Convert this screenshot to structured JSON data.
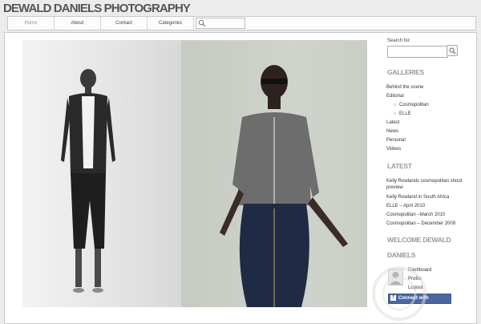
{
  "site": {
    "title": "DEWALD DANIELS PHOTOGRAPHY"
  },
  "nav": {
    "items": [
      {
        "label": "Home"
      },
      {
        "label": "About"
      },
      {
        "label": "Contact"
      },
      {
        "label": "Categories"
      }
    ],
    "search_icon": "search-icon"
  },
  "sidebar": {
    "search": {
      "label": "Search for:",
      "value": ""
    },
    "galleries": {
      "title": "GALLERIES",
      "items": [
        "Behind the scene",
        "Editorial",
        "Latest",
        "News",
        "Personal",
        "Videos"
      ],
      "editorial_sub": [
        "Cosmopolitan",
        "ELLE"
      ]
    },
    "latest": {
      "title": "LATEST",
      "items": [
        "Kelly Rowlands cosmopolitan shoot preview",
        "Kelly Rowland in South Africa",
        "ELLE – April 2010",
        "Cosmopolitan –March 2010",
        "Cosmopolitan – December 2009"
      ]
    },
    "welcome": {
      "title_line1": "WELCOME DEWALD",
      "title_line2": "DANIELS",
      "links": [
        "Dashboard",
        "Profile",
        "Logout"
      ]
    },
    "facebook": {
      "label": "Connect with Facebook",
      "icon": "facebook-icon"
    }
  },
  "colors": {
    "page_bg": "#ececec",
    "title": "#555555",
    "widget_title": "#9a9a9a",
    "facebook": "#4b67a1"
  }
}
